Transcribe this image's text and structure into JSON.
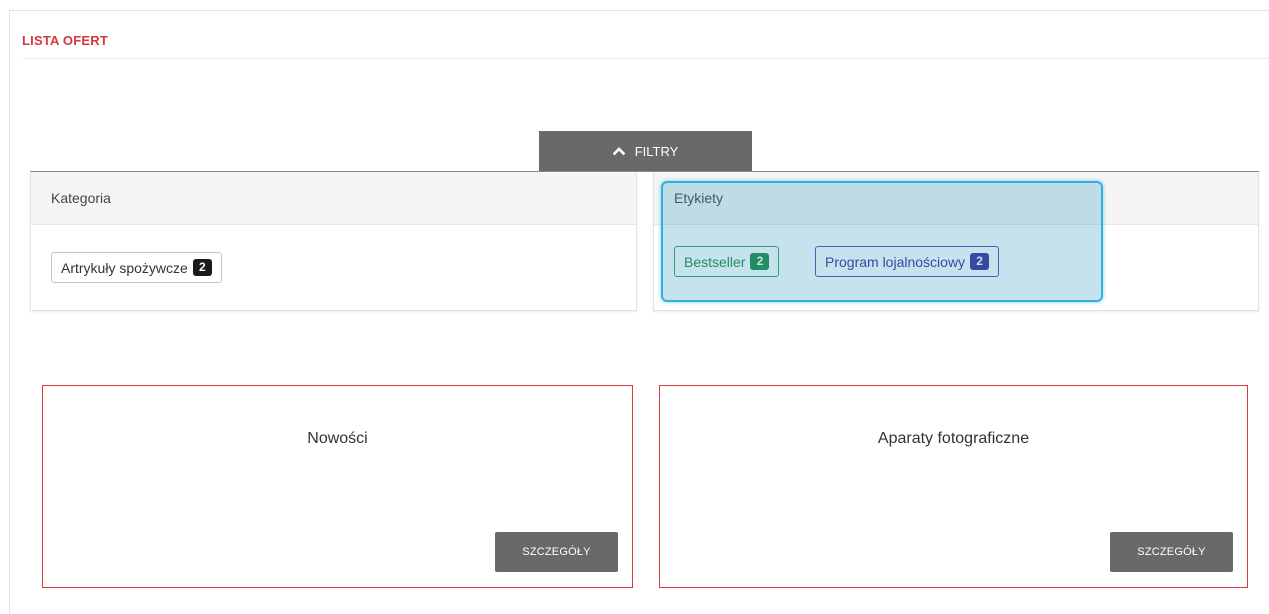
{
  "page": {
    "title": "LISTA OFERT"
  },
  "filters": {
    "toggle_label": "FILTRY",
    "toggle_icon": "chevron-up-icon",
    "kategoria": {
      "heading": "Kategoria",
      "options": [
        {
          "label": "Artrykuły spożywcze",
          "count": "2"
        }
      ]
    },
    "etykiety": {
      "heading": "Etykiety",
      "options": [
        {
          "label": "Bestseller",
          "count": "2",
          "color": "#1e8a3c"
        },
        {
          "label": "Program lojalnościowy",
          "count": "2",
          "color": "#3d2a9a"
        }
      ]
    }
  },
  "offers": [
    {
      "title": "Nowości",
      "button_label": "SZCZEGÓŁY"
    },
    {
      "title": "Aparaty fotograficzne",
      "button_label": "SZCZEGÓŁY"
    }
  ],
  "colors": {
    "accent": "#d9363e",
    "button": "#696969",
    "highlight": "#2fb0e0"
  }
}
